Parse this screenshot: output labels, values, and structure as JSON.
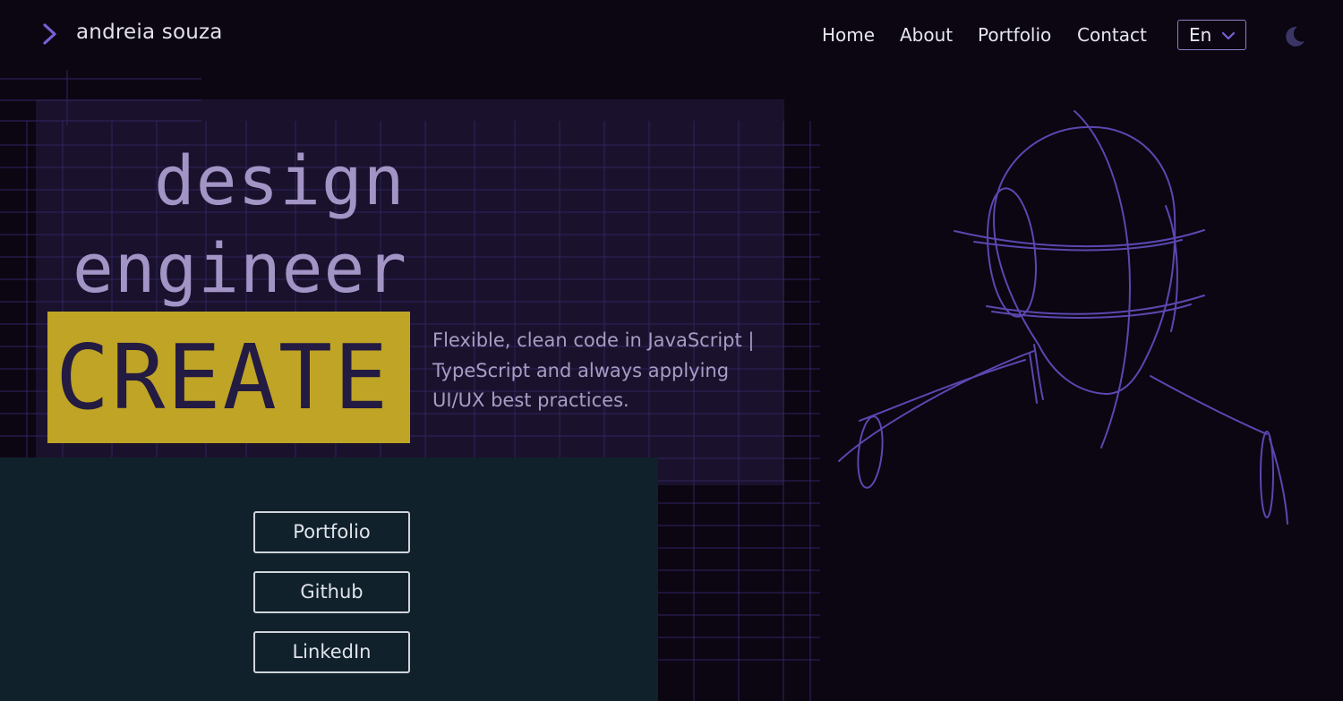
{
  "header": {
    "logo_text": "andreia souza",
    "nav": [
      "Home",
      "About",
      "Portfolio",
      "Contact"
    ],
    "language": "En"
  },
  "hero": {
    "title_line1": "design",
    "title_line2": "engineer",
    "highlight": "CREATE",
    "tagline": "Flexible, clean code in JavaScript | TypeScript and always applying UI/UX best practices."
  },
  "links": [
    "Portfolio",
    "Github",
    "LinkedIn"
  ],
  "colors": {
    "background": "#0b0612",
    "accent": "#7a5fd6",
    "highlight": "#bfa425",
    "panel": "#11212c"
  },
  "icons": [
    "chevron-right-icon",
    "chevron-down-icon",
    "moon-icon"
  ]
}
